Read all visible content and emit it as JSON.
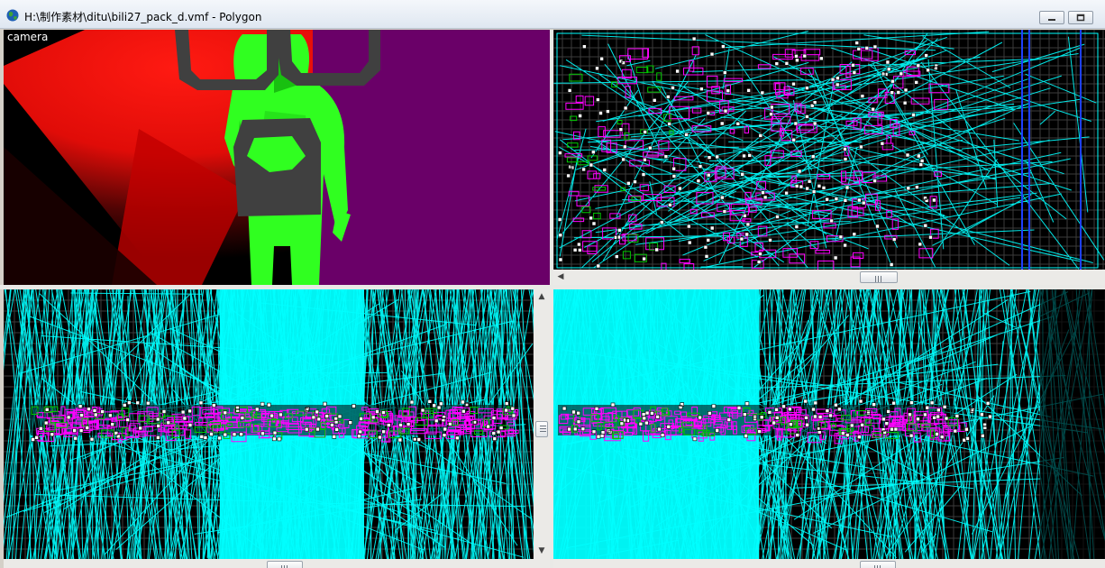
{
  "window": {
    "title": "H:\\制作素材\\ditu\\bili27_pack_d.vmf - Polygon",
    "icon": "globe-icon",
    "buttons": [
      "minimize-button",
      "restore-button"
    ]
  },
  "viewports": {
    "camera": {
      "label": "camera"
    },
    "top": {
      "label": ""
    },
    "front": {
      "label": ""
    },
    "side": {
      "label": ""
    }
  },
  "colors": {
    "background_black": "#000000",
    "wire_cyan": "#00ffff",
    "brush_magenta": "#ff00ff",
    "entity_green": "#00c800",
    "skybox_purple": "#6a0068",
    "light_red": "#ff1010",
    "model_green": "#30ff20",
    "model_gray": "#404040"
  }
}
